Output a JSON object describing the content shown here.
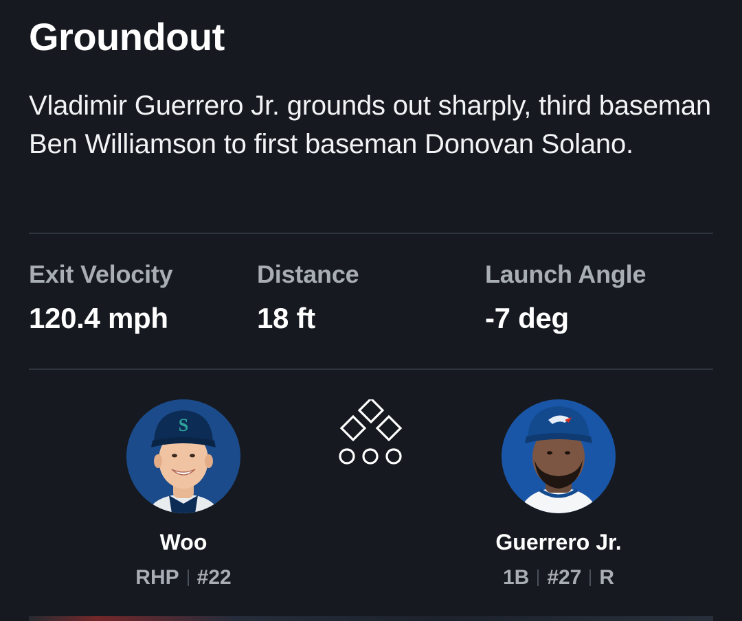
{
  "play": {
    "title": "Groundout",
    "description": "Vladimir Guerrero Jr. grounds out sharply, third baseman Ben Williamson to first baseman Donovan Solano."
  },
  "stats": [
    {
      "label": "Exit Velocity",
      "value": "120.4 mph"
    },
    {
      "label": "Distance",
      "value": "18 ft"
    },
    {
      "label": "Launch Angle",
      "value": "-7 deg"
    }
  ],
  "pitcher": {
    "name": "Woo",
    "meta": [
      "RHP",
      "#22"
    ],
    "avatar_icon": "mariners-player-headshot",
    "team_color": "#0c2c56",
    "cap_logo": "S"
  },
  "batter": {
    "name": "Guerrero Jr.",
    "meta": [
      "1B",
      "#27",
      "R"
    ],
    "avatar_icon": "blue-jays-player-headshot",
    "team_color": "#134a8e"
  },
  "game_state": {
    "bases_icon": "bases-diamond-icon",
    "outs_icon": "outs-indicator-icon",
    "bases_occupied": [
      false,
      false,
      false
    ],
    "outs": 0
  }
}
